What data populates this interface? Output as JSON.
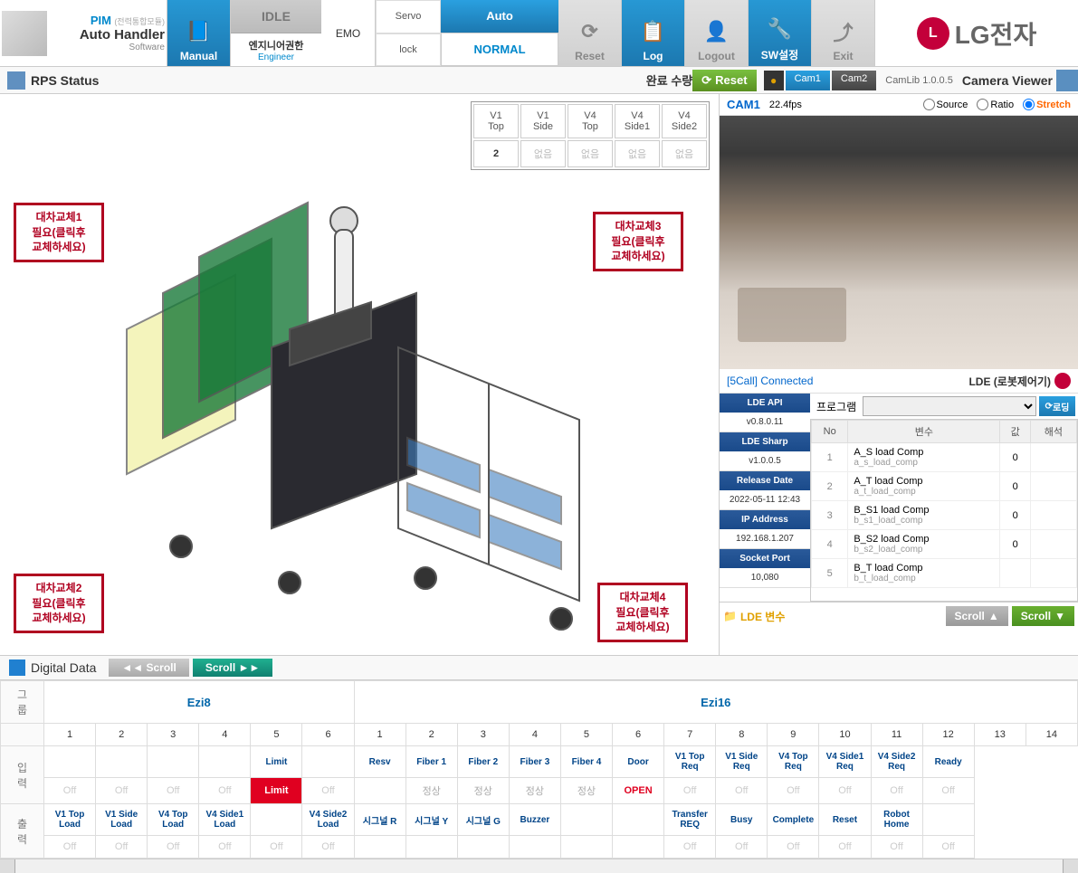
{
  "app": {
    "pim": "PIM",
    "pim_sub": "(전력통합모듈)",
    "name": "Auto Handler",
    "software": "Software"
  },
  "toolbar": {
    "manual": "Manual",
    "idle": "IDLE",
    "engineer": "엔지니어권한",
    "engineer_en": "Engineer",
    "emo": "EMO",
    "servo": "Servo",
    "lock": "lock",
    "auto": "Auto",
    "normal": "NORMAL",
    "reset": "Reset",
    "log": "Log",
    "logout": "Logout",
    "sw": "SW설정",
    "exit": "Exit",
    "lg": "LG전자"
  },
  "status": {
    "title": "RPS Status",
    "complete_qty": "완료 수량",
    "reset": "Reset",
    "cam1": "Cam1",
    "cam2": "Cam2",
    "camlib": "CamLib 1.0.0.5",
    "camera_viewer": "Camera Viewer"
  },
  "count_table": {
    "headers": [
      "V1\nTop",
      "V1\nSide",
      "V4\nTop",
      "V4\nSide1",
      "V4\nSide2"
    ],
    "values": [
      "2",
      "없음",
      "없음",
      "없음",
      "없음"
    ]
  },
  "swap": {
    "b1": "대차교체1\n필요(클릭후\n교체하세요)",
    "b2": "대차교체2\n필요(클릭후\n교체하세요)",
    "b3": "대차교체3\n필요(클릭후\n교체하세요)",
    "b4": "대차교체4\n필요(클릭후\n교체하세요)"
  },
  "camera": {
    "name": "CAM1",
    "fps": "22.4fps",
    "source": "Source",
    "ratio": "Ratio",
    "stretch": "Stretch"
  },
  "lde": {
    "status": "[5Call] Connected",
    "title": "LDE (로봇제어기)",
    "api_h": "LDE API",
    "api_v": "v0.8.0.11",
    "sharp_h": "LDE Sharp",
    "sharp_v": "v1.0.0.5",
    "rel_h": "Release Date",
    "rel_v": "2022-05-11 12:43",
    "ip_h": "IP Address",
    "ip_v": "192.168.1.207",
    "port_h": "Socket Port",
    "port_v": "10,080",
    "program": "프로그램",
    "reload": "로딩",
    "cols": {
      "no": "No",
      "var": "변수",
      "val": "값",
      "desc": "해석"
    },
    "rows": [
      {
        "n": "1",
        "name": "A_S load Comp",
        "sub": "a_s_load_comp",
        "v": "0"
      },
      {
        "n": "2",
        "name": "A_T load Comp",
        "sub": "a_t_load_comp",
        "v": "0"
      },
      {
        "n": "3",
        "name": "B_S1 load Comp",
        "sub": "b_s1_load_comp",
        "v": "0"
      },
      {
        "n": "4",
        "name": "B_S2 load Comp",
        "sub": "b_s2_load_comp",
        "v": "0"
      },
      {
        "n": "5",
        "name": "B_T load Comp",
        "sub": "b_t_load_comp",
        "v": ""
      }
    ],
    "vars_lbl": "LDE 변수",
    "scroll": "Scroll"
  },
  "dd": {
    "title": "Digital Data",
    "scroll": "Scroll",
    "group": "그\n룹",
    "input": "입\n력",
    "output": "출\n력",
    "g1": "Ezi8",
    "g2": "Ezi16",
    "nums": [
      "1",
      "2",
      "3",
      "4",
      "5",
      "6",
      "1",
      "2",
      "3",
      "4",
      "5",
      "6",
      "7",
      "8",
      "9",
      "10",
      "11",
      "12",
      "13",
      "14"
    ],
    "in_sig": [
      "",
      "",
      "",
      "",
      "Limit",
      "",
      "Resv",
      "Fiber 1",
      "Fiber 2",
      "Fiber 3",
      "Fiber 4",
      "Door",
      "V1 Top Req",
      "V1 Side Req",
      "V4 Top Req",
      "V4 Side1 Req",
      "V4 Side2 Req",
      "Ready"
    ],
    "in_val": [
      "Off",
      "Off",
      "Off",
      "Off",
      "Limit",
      "Off",
      "",
      "정상",
      "정상",
      "정상",
      "정상",
      "OPEN",
      "Off",
      "Off",
      "Off",
      "Off",
      "Off",
      "Off"
    ],
    "out_sig": [
      "V1 Top Load",
      "V1 Side Load",
      "V4 Top Load",
      "V4 Side1 Load",
      "",
      "V4 Side2 Load",
      "시그널 R",
      "시그널 Y",
      "시그널 G",
      "Buzzer",
      "",
      "",
      "Transfer REQ",
      "Busy",
      "Complete",
      "Reset",
      "Robot Home",
      ""
    ],
    "out_val": [
      "Off",
      "Off",
      "Off",
      "Off",
      "Off",
      "Off",
      "",
      "",
      "",
      "",
      "",
      "",
      "Off",
      "Off",
      "Off",
      "Off",
      "Off",
      "Off"
    ]
  }
}
